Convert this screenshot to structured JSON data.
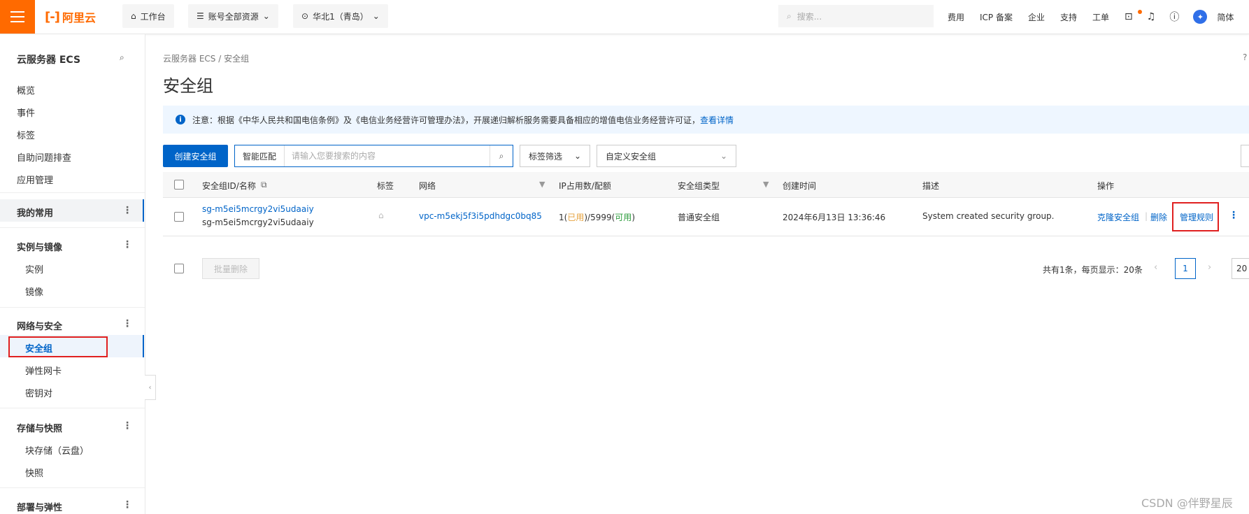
{
  "topbar": {
    "logo_text": "阿里云",
    "workbench": "工作台",
    "resources": "账号全部资源",
    "region": "华北1（青岛）",
    "search_placeholder": "搜索...",
    "links": [
      "费用",
      "ICP 备案",
      "企业",
      "支持",
      "工单"
    ],
    "language": "简体"
  },
  "sidebar": {
    "title": "云服务器 ECS",
    "items": [
      "概览",
      "事件",
      "标签",
      "自助问题排查",
      "应用管理"
    ],
    "favorites": "我的常用",
    "groups": [
      {
        "label": "实例与镜像",
        "items": [
          "实例",
          "镜像"
        ]
      },
      {
        "label": "网络与安全",
        "items": [
          "安全组",
          "弹性网卡",
          "密钥对"
        ]
      },
      {
        "label": "存储与快照",
        "items": [
          "块存储（云盘）",
          "快照"
        ]
      },
      {
        "label": "部署与弹性",
        "items": []
      }
    ]
  },
  "main": {
    "breadcrumb": "云服务器 ECS  /  安全组",
    "title": "安全组",
    "notice_text": "注意：根据《中华人民共和国电信条例》及《电信业务经营许可管理办法》，开展递归解析服务需要具备相应的增值电信业务经营许可证，",
    "notice_link": "查看详情",
    "create_button": "创建安全组",
    "smart_match": "智能匹配",
    "search_placeholder": "请输入您要搜索的内容",
    "tag_filter": "标签筛选",
    "custom_group": "自定义安全组",
    "table": {
      "headers": [
        "安全组ID/名称",
        "标签",
        "网络",
        "IP占用数/配额",
        "安全组类型",
        "创建时间",
        "描述",
        "操作"
      ],
      "rows": [
        {
          "id": "sg-m5ei5mcrgy2vi5udaaiy",
          "name": "sg-m5ei5mcrgy2vi5udaaiy",
          "network": "vpc-m5ekj5f3i5pdhdgc0bq85",
          "ip_prefix": "1(",
          "ip_used": "已用",
          "ip_mid": ")/5999(",
          "ip_avail": "可用",
          "ip_suffix": ")",
          "type": "普通安全组",
          "created": "2024年6月13日 13:36:46",
          "description": "System created security group.",
          "actions": [
            "克隆安全组",
            "删除",
            "管理规则"
          ]
        }
      ]
    },
    "batch_delete": "批量删除",
    "pager_text": "共有1条，每页显示：20条",
    "current_page": "1",
    "page_size": "20"
  },
  "watermark": "CSDN @伴野星辰",
  "colors": {
    "brand": "#ff6a00",
    "primary": "#0064c8",
    "highlight_box": "#e02020"
  }
}
